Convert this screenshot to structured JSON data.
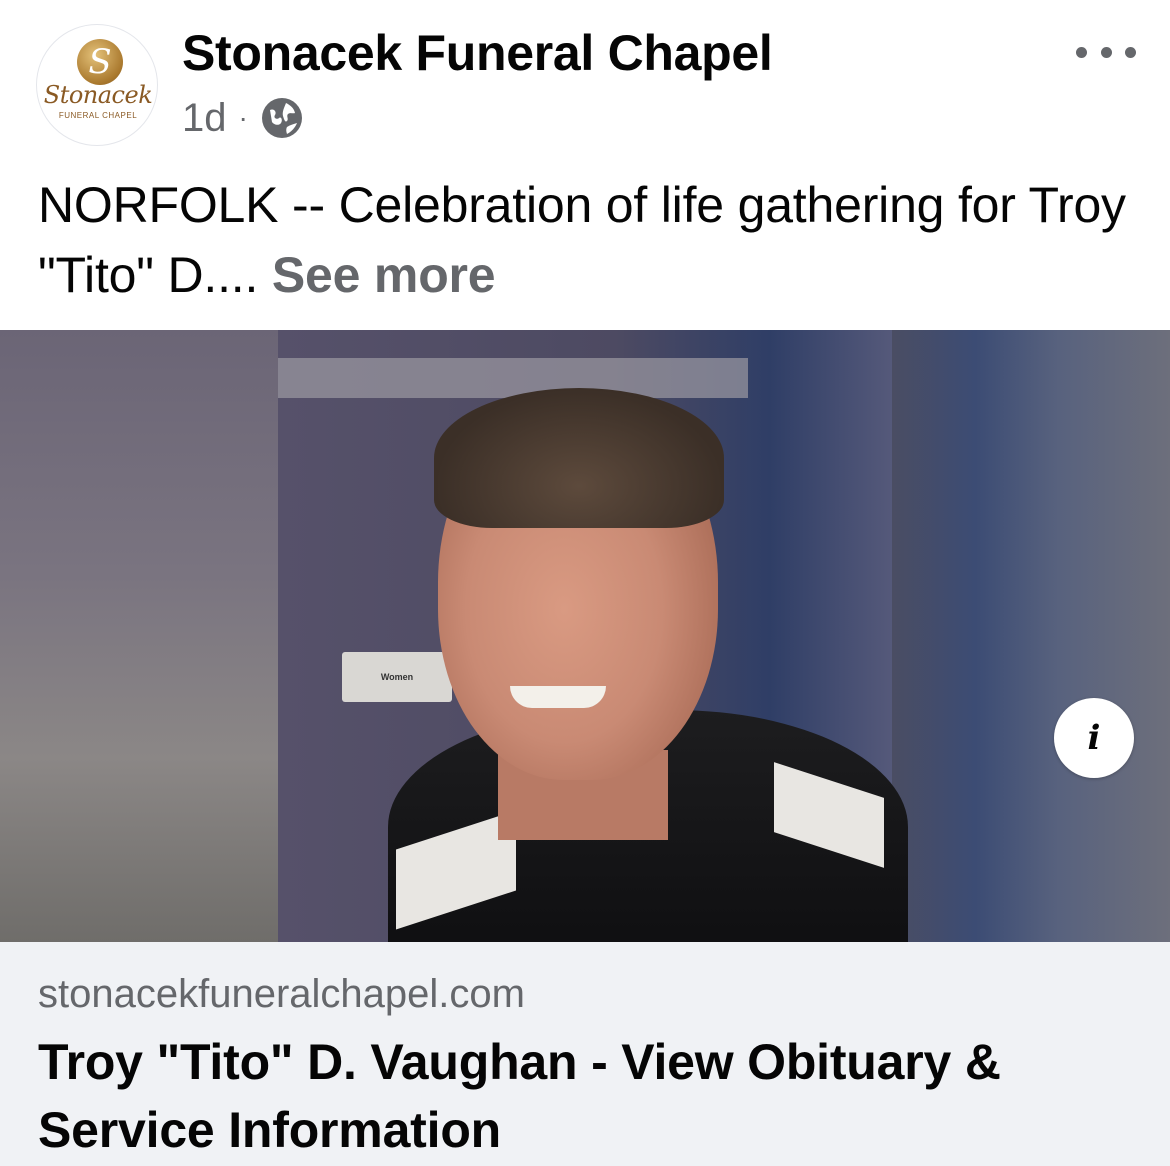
{
  "post": {
    "page_name": "Stonacek Funeral Chapel",
    "avatar": {
      "monogram": "S",
      "script_text": "Stonacek",
      "sub_text": "FUNERAL CHAPEL"
    },
    "timestamp": "1d",
    "separator": "·",
    "audience_icon": "globe-icon",
    "more_icon": "more-options-icon",
    "text": "NORFOLK -- Celebration of life gathering for Troy \"Tito\" D....",
    "see_more_label": "See more"
  },
  "photo": {
    "sign_text": "Women",
    "info_icon": "info-icon",
    "info_glyph": "i"
  },
  "link_preview": {
    "domain": "stonacekfuneralchapel.com",
    "title": "Troy \"Tito\" D. Vaughan - View Obituary & Service Information"
  },
  "colors": {
    "text_primary": "#050505",
    "text_secondary": "#65676b",
    "link_card_bg": "#f0f2f5",
    "brand_gold": "#a9782d"
  }
}
